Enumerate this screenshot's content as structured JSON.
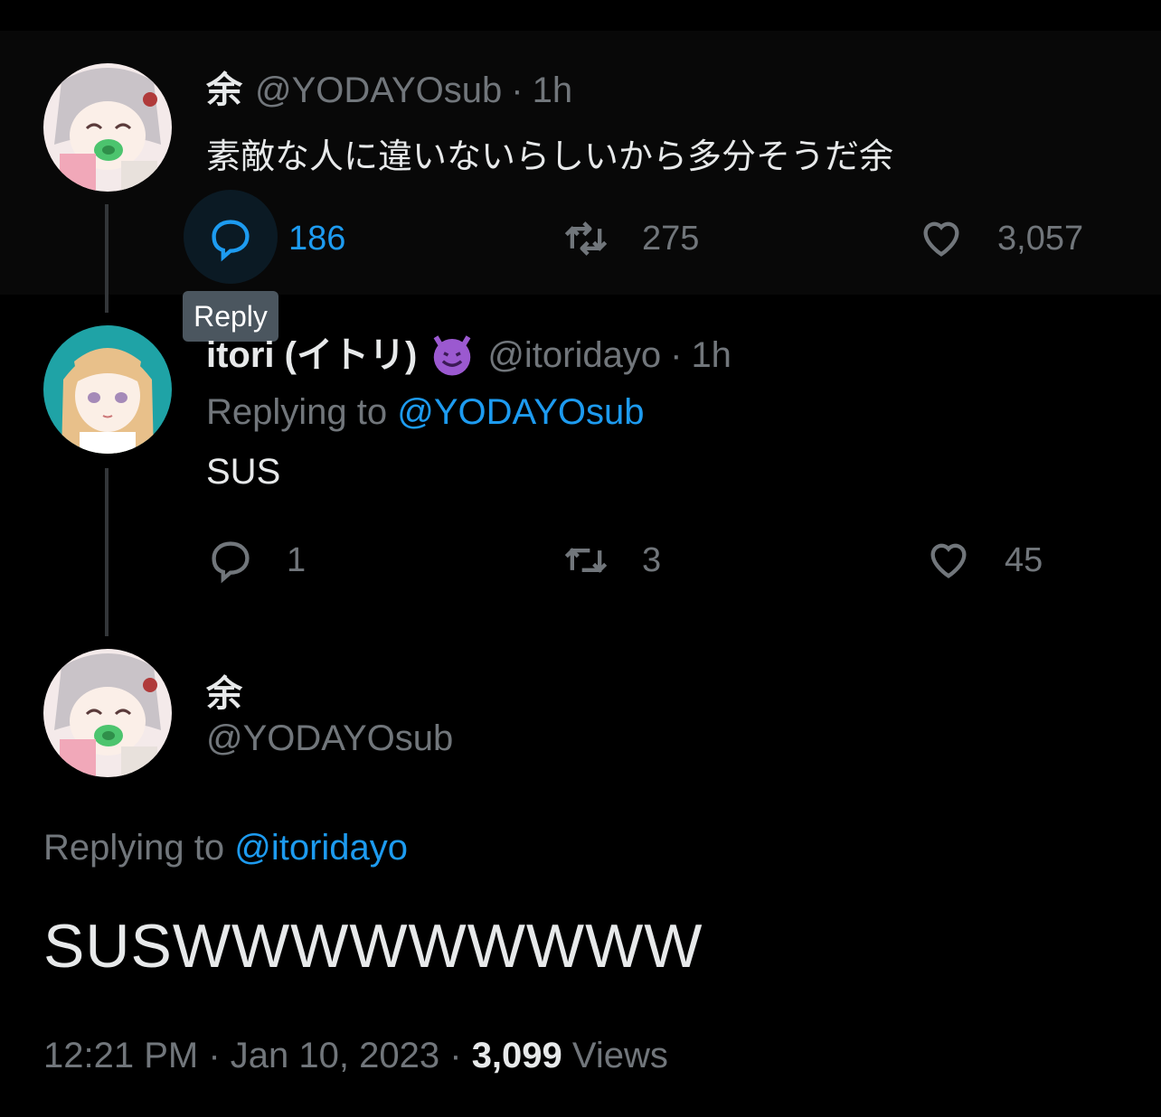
{
  "tweet1": {
    "name": "余",
    "handle": "@YODAYOsub",
    "dot": "·",
    "time": "1h",
    "text": "素敵な人に違いないらしいから多分そうだ余",
    "replies": "186",
    "retweets": "275",
    "likes": "3,057",
    "tooltip": "Reply"
  },
  "tweet2": {
    "name": "itori (イトリ)",
    "emoji": "smiling-devil-emoji",
    "handle": "@itoridayo",
    "dot": "·",
    "time": "1h",
    "replying_prefix": "Replying to",
    "replying_to": "@YODAYOsub",
    "text": "SUS",
    "replies": "1",
    "retweets": "3",
    "likes": "45"
  },
  "main_tweet": {
    "name": "余",
    "handle": "@YODAYOsub",
    "replying_prefix": "Replying to",
    "replying_to": "@itoridayo",
    "text": "SUSWWWWWWWWW",
    "time": "12:21 PM",
    "dot1": "·",
    "date": "Jan 10, 2023",
    "dot2": "·",
    "views_count": "3,099",
    "views_label": "Views"
  },
  "colors": {
    "background": "#000000",
    "text": "#e7e9ea",
    "muted": "#71767b",
    "link": "#1d9bf0",
    "thread_line": "#333639"
  }
}
